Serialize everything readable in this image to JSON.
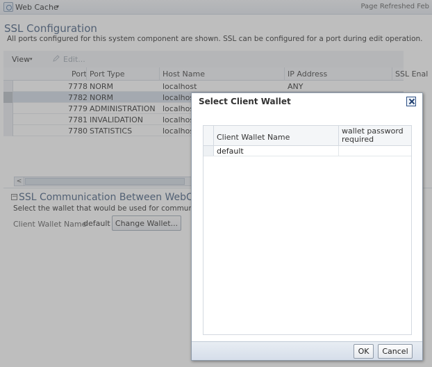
{
  "topbar": {
    "app_title": "Web Cache",
    "app_icon": "web-cache-icon",
    "menu_caret": "▾",
    "refreshed": "Page Refreshed Feb"
  },
  "page": {
    "title": "SSL Configuration",
    "description": "All ports configured for this system component are shown. SSL can be configured for a port during edit operation."
  },
  "toolbar": {
    "view_label": "View",
    "view_caret": "▾",
    "edit_label": "Edit..."
  },
  "table": {
    "columns": [
      "Port",
      "Port Type",
      "Host Name",
      "IP Address",
      "SSL Enal"
    ],
    "rows": [
      {
        "port": "7778",
        "type": "NORM",
        "host": "localhost",
        "ip": "ANY"
      },
      {
        "port": "7782",
        "type": "NORM",
        "host": "localhost",
        "ip": ""
      },
      {
        "port": "7779",
        "type": "ADMINISTRATION",
        "host": "localhost",
        "ip": ""
      },
      {
        "port": "7781",
        "type": "INVALIDATION",
        "host": "localhost",
        "ip": ""
      },
      {
        "port": "7780",
        "type": "STATISTICS",
        "host": "localhost",
        "ip": ""
      }
    ],
    "selected_row": 1,
    "scroll_left_glyph": "<"
  },
  "ssl_section": {
    "collapse_glyph": "−",
    "title": "SSL Communication Between WebC",
    "description": "Select the wallet that would be used for communicatio",
    "client_wallet_label": "Client Wallet Name",
    "client_wallet_value": "default",
    "change_wallet_label": "Change Wallet..."
  },
  "dialog": {
    "title": "Select Client Wallet",
    "columns": {
      "name": "Client Wallet Name",
      "password": "wallet password required"
    },
    "rows": [
      {
        "name": "default",
        "password": ""
      }
    ],
    "ok_label": "OK",
    "cancel_label": "Cancel"
  }
}
